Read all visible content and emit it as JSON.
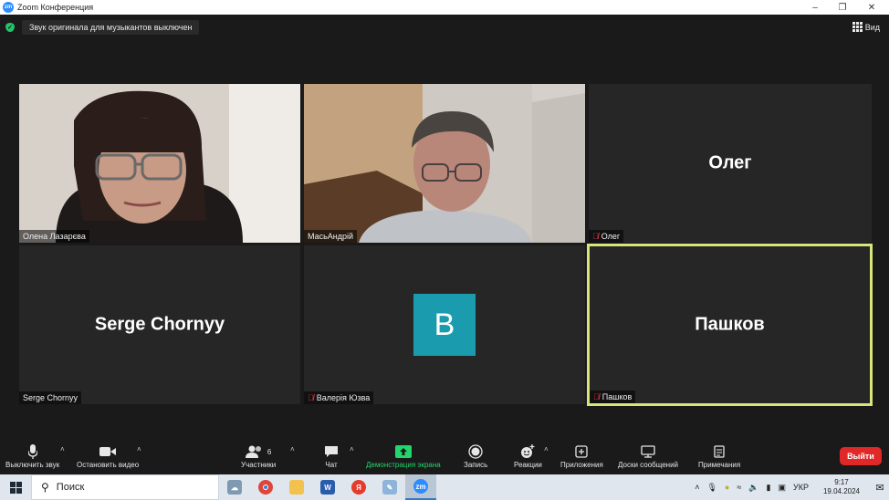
{
  "window": {
    "title": "Zoom Конференция"
  },
  "banner": {
    "text": "Звук оригинала для музыкантов выключен"
  },
  "view": {
    "label": "Вид"
  },
  "participants": [
    {
      "name": "Олена Лазарєва",
      "big_name": "",
      "muted": false,
      "video": true
    },
    {
      "name": "МасьАндрій",
      "big_name": "",
      "muted": false,
      "video": true
    },
    {
      "name": "Олег",
      "big_name": "Олег",
      "muted": true,
      "video": false
    },
    {
      "name": "Serge Chornyy",
      "big_name": "Serge Chornyy",
      "muted": false,
      "video": false
    },
    {
      "name": "Валерія Юзва",
      "big_name": "",
      "avatar_letter": "В",
      "muted": true,
      "video": false
    },
    {
      "name": "Пашков",
      "big_name": "Пашков",
      "muted": true,
      "video": false,
      "active_speaker": true
    }
  ],
  "toolbar": {
    "mute_label": "Выключить звук",
    "video_label": "Остановить видео",
    "participants_label": "Участники",
    "participants_count": "6",
    "chat_label": "Чат",
    "share_label": "Демонстрация экрана",
    "record_label": "Запись",
    "reactions_label": "Реакции",
    "apps_label": "Приложения",
    "whiteboards_label": "Доски сообщений",
    "notes_label": "Примечания",
    "leave_label": "Выйти"
  },
  "taskbar": {
    "search_placeholder": "Поиск",
    "language": "УКР",
    "time": "9:17",
    "date": "19.04.2024"
  },
  "colors": {
    "active_border": "#d9e57a",
    "avatar_bg": "#1b9cae",
    "leave_bg": "#e02828",
    "share_green": "#23d56b"
  }
}
